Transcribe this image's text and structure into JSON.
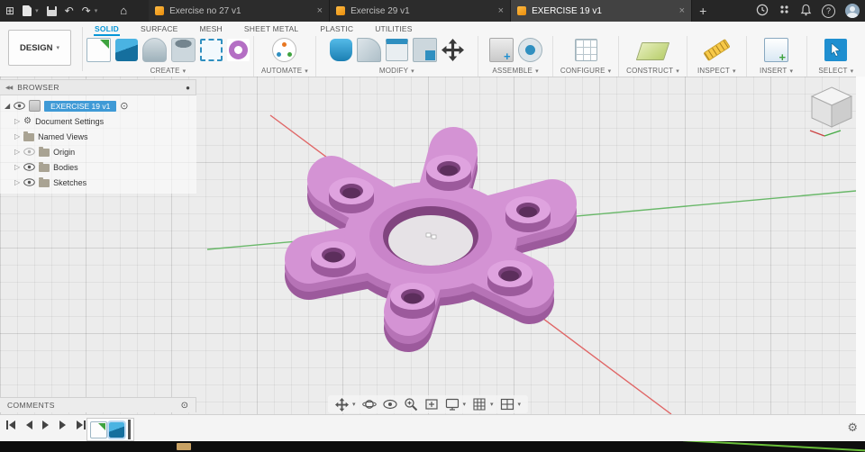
{
  "colors": {
    "accent": "#0696d7",
    "selection": "#3f9ad6",
    "model_top": "#d493d4",
    "model_side": "#9c5a9c",
    "axis_x_red": "#e06666",
    "axis_y_green": "#69b869",
    "doc_icon_orange": "#f2a21c"
  },
  "titlebar": {
    "tabs": [
      {
        "label": "Exercise no 27 v1",
        "active": false
      },
      {
        "label": "Exercise 29 v1",
        "active": false
      },
      {
        "label": "EXERCISE 19 v1",
        "active": true
      }
    ]
  },
  "ribbon": {
    "design_button": "DESIGN",
    "tabs": [
      {
        "label": "SOLID",
        "active": true
      },
      {
        "label": "SURFACE",
        "active": false
      },
      {
        "label": "MESH",
        "active": false
      },
      {
        "label": "SHEET METAL",
        "active": false
      },
      {
        "label": "PLASTIC",
        "active": false
      },
      {
        "label": "UTILITIES",
        "active": false
      }
    ],
    "groups": [
      {
        "label": "CREATE"
      },
      {
        "label": "AUTOMATE"
      },
      {
        "label": "MODIFY"
      },
      {
        "label": "ASSEMBLE"
      },
      {
        "label": "CONFIGURE"
      },
      {
        "label": "CONSTRUCT"
      },
      {
        "label": "INSPECT"
      },
      {
        "label": "INSERT"
      },
      {
        "label": "SELECT"
      }
    ]
  },
  "browser": {
    "title": "BROWSER",
    "root_label": "EXERCISE 19 v1",
    "items": [
      {
        "label": "Document Settings"
      },
      {
        "label": "Named Views"
      },
      {
        "label": "Origin"
      },
      {
        "label": "Bodies"
      },
      {
        "label": "Sketches"
      }
    ]
  },
  "comments": {
    "title": "COMMENTS"
  },
  "icons": {
    "caret": "▾",
    "close": "×",
    "plus": "+",
    "collapse": "◀◀",
    "radio": "⊙",
    "dot": "●",
    "gear": "⚙",
    "home": "⌂",
    "undo": "↶",
    "redo": "↷",
    "app_grid": "⊞",
    "help": "?",
    "expand_open": "◢",
    "expand_closed": "▷"
  }
}
